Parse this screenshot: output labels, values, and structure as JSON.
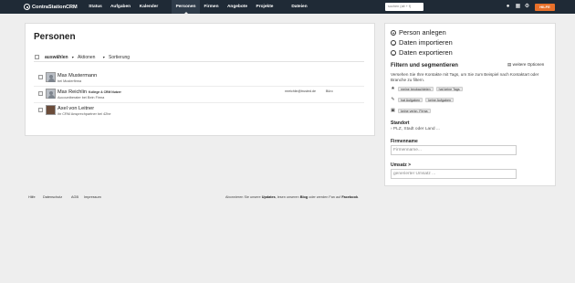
{
  "app": {
    "name": "ContraStationCRM"
  },
  "nav": {
    "items": [
      "Status",
      "Aufgaben",
      "Kalender",
      "Personen",
      "Firmen",
      "Angebote",
      "Projekte",
      "Dateien"
    ],
    "active": "Personen"
  },
  "search": {
    "placeholder": "suchen (alt + f)"
  },
  "help_label": "HILFE",
  "colors": {
    "topbar": "#1f2a36",
    "accent": "#e8702a"
  },
  "main": {
    "title": "Personen",
    "toolbar": {
      "select_label": "auswählen",
      "actions_label": "Aktionen",
      "sort_label": "Sortierung"
    },
    "rows": [
      {
        "name": "Max Mustermann",
        "sub": "bei Musterfirma",
        "tags": "",
        "email": "",
        "phone": ""
      },
      {
        "name": "Max Reichlin",
        "sub": "Accountberater bei Bein Firma",
        "tags": "Kollege & CRM Nutzer",
        "email": "mreichlin@trusted.de",
        "phone": "Büro"
      },
      {
        "name": "Axel von Leitner",
        "sub": "ihr CRM Ansprechpartner bei 42he",
        "tags": "",
        "email": "",
        "phone": ""
      }
    ]
  },
  "side": {
    "actions": [
      "Person anlegen",
      "Daten importieren",
      "Daten exportieren"
    ],
    "filter_title": "Filtern und segmentieren",
    "more_options": "weitere Optionen",
    "help_text": "Versehen Sie Ihre Kontakte mit Tags, um Sie zum Beispiel nach Kontaktart oder Branche zu filtern.",
    "filters": [
      {
        "icon": "star-icon",
        "pills": [
          "meine beobachteten",
          "hat keine Tags"
        ]
      },
      {
        "icon": "pencil-icon",
        "pills": [
          "hat Aufgaben",
          "keine Aufgaben"
        ]
      },
      {
        "icon": "briefcase-icon",
        "pills": [
          "keine verkn. Firma"
        ]
      }
    ],
    "standort_label": "Standort",
    "standort_link": "› PLZ, Stadt oder Land ...",
    "firmenname_label": "Firmenname",
    "firmenname_placeholder": "Firmenname...",
    "umsatz_label": "Umsatz >",
    "umsatz_placeholder": "generierter Umsatz ..."
  },
  "footer": {
    "links": [
      "Hilfe",
      "Datenschutz",
      "AGB",
      "Impressum"
    ],
    "text_1": "Abonnieren Sie unsere",
    "updates": "Updates",
    "text_2": ", lesen unseren",
    "blog": "Blog",
    "text_3": "oder werden Fan auf",
    "facebook": "Facebook",
    "text_4": "."
  }
}
